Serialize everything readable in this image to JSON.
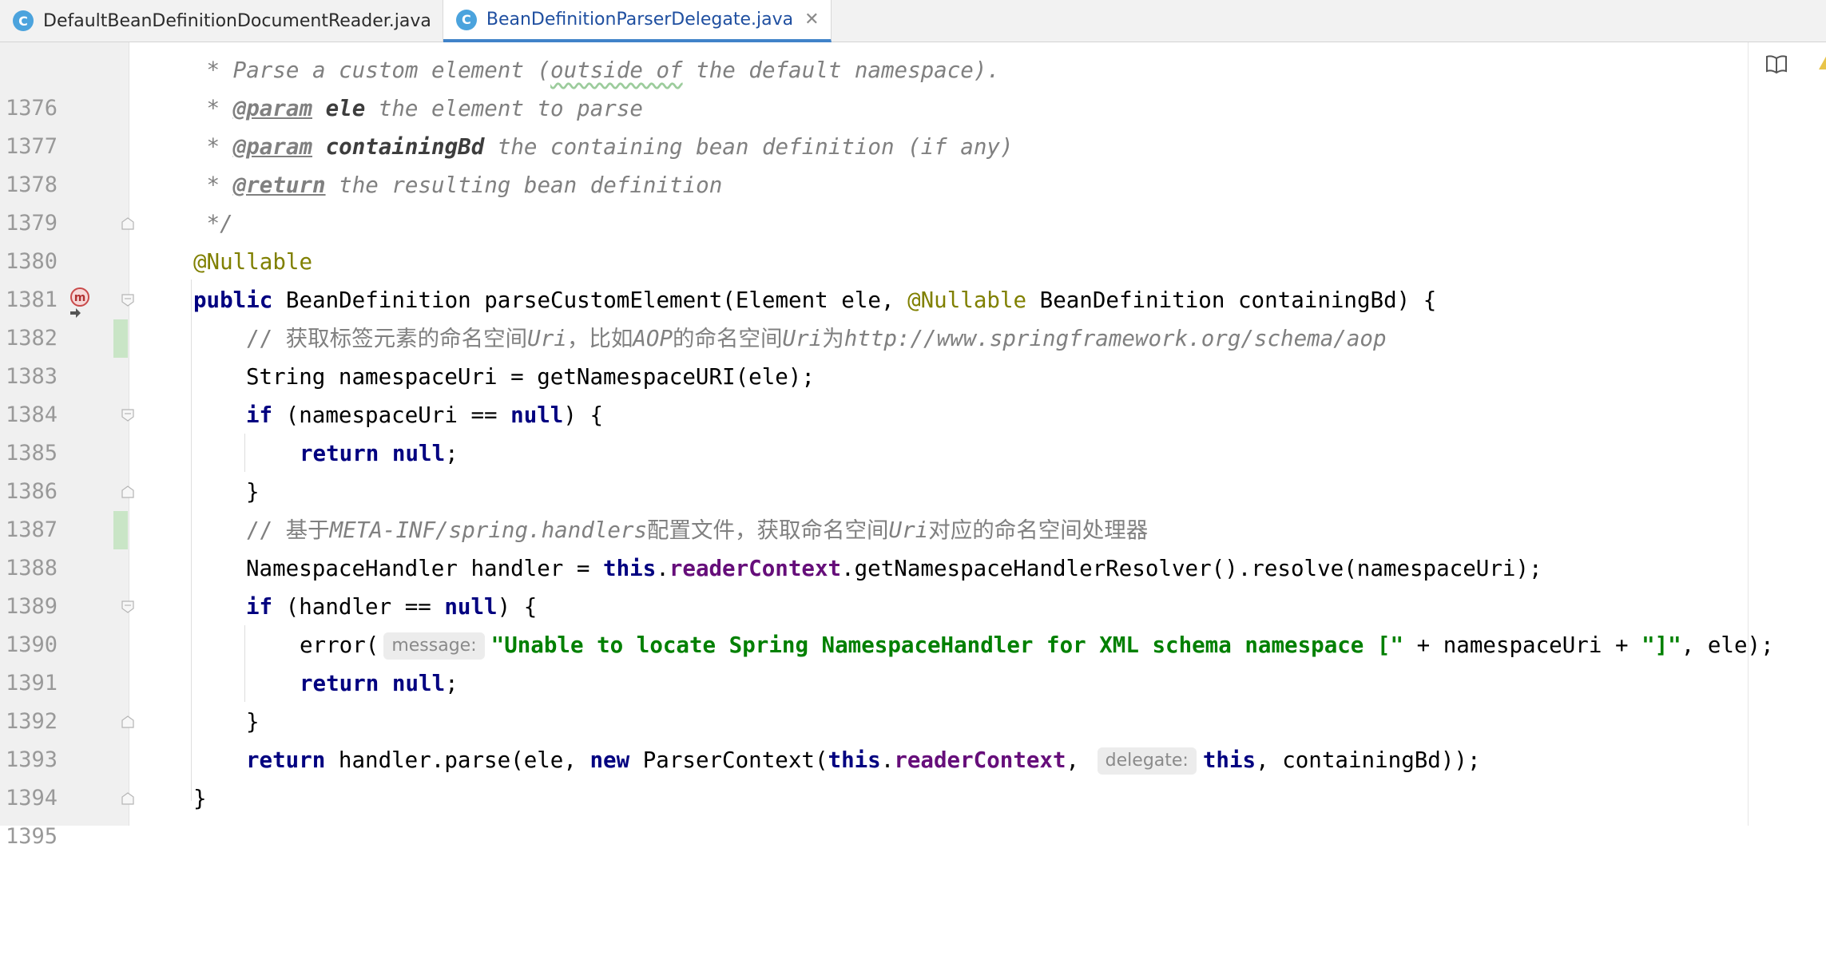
{
  "tabs": [
    {
      "label": "DefaultBeanDefinitionDocumentReader.java",
      "icon": "C",
      "active": false
    },
    {
      "label": "BeanDefinitionParserDelegate.java",
      "icon": "C",
      "active": true
    }
  ],
  "tab_close_glyph": "✕",
  "line_numbers": [
    "1376",
    "1377",
    "1378",
    "1379",
    "1380",
    "1381",
    "1382",
    "1383",
    "1384",
    "1385",
    "1386",
    "1387",
    "1388",
    "1389",
    "1390",
    "1391",
    "1392",
    "1393",
    "1394",
    "1395"
  ],
  "code": {
    "l1376": {
      "a": " * Parse a custom element (",
      "b": "outside of",
      "c": " the default namespace)."
    },
    "l1377": {
      "star": " * ",
      "tag": "@param",
      "name": "ele",
      "rest": " the element to parse"
    },
    "l1378": {
      "star": " * ",
      "tag": "@param",
      "name": "containingBd",
      "rest": " the containing bean definition (if any)"
    },
    "l1379": {
      "star": " * ",
      "tag": "@return",
      "rest": " the resulting bean definition"
    },
    "l1380": {
      "text": " */"
    },
    "l1381": {
      "ann": "@Nullable"
    },
    "l1382": {
      "kw": "public",
      "a": " BeanDefinition parseCustomElement(Element ele, ",
      "ann": "@Nullable",
      "b": " BeanDefinition containingBd) {"
    },
    "l1383": {
      "c1": "// 获取标签元素的命名空间",
      "c2": "Uri",
      "c3": "，比如",
      "c4": "AOP",
      "c5": "的命名空间",
      "c6": "Uri",
      "c7": "为",
      "c8": "http://www.springframework.org/schema/aop"
    },
    "l1384": {
      "text": "String namespaceUri = getNamespaceURI(ele);"
    },
    "l1385": {
      "kw": "if",
      "a": " (namespaceUri == ",
      "kw2": "null",
      "b": ") {"
    },
    "l1386": {
      "kw": "return",
      "sp": " ",
      "kw2": "null",
      "b": ";"
    },
    "l1387": {
      "text": "}"
    },
    "l1388": {
      "c1": "// 基于",
      "c2": "META-INF/spring.handlers",
      "c3": "配置文件，获取命名空间",
      "c4": "Uri",
      "c5": "对应的命名空间处理器"
    },
    "l1389": {
      "a": "NamespaceHandler handler = ",
      "kw": "this",
      "dot": ".",
      "fld": "readerContext",
      "b": ".getNamespaceHandlerResolver().resolve(namespaceUri);"
    },
    "l1390": {
      "kw": "if",
      "a": " (handler == ",
      "kw2": "null",
      "b": ") {"
    },
    "l1391": {
      "a": "error(",
      "hint": "message:",
      "str": "\"Unable to locate Spring NamespaceHandler for XML schema namespace [\"",
      "b": " + namespaceUri + ",
      "str2": "\"]\"",
      "c": ", ele);"
    },
    "l1392": {
      "kw": "return",
      "sp": " ",
      "kw2": "null",
      "b": ";"
    },
    "l1393": {
      "text": "}"
    },
    "l1394": {
      "kw": "return",
      "a": " handler.parse(ele, ",
      "kw2": "new",
      "b": " ParserContext(",
      "kw3": "this",
      "dot": ".",
      "fld": "readerContext",
      "c": ", ",
      "hint": "delegate:",
      "kw4": "this",
      "d": ", containingBd));"
    },
    "l1395": {
      "text": "}"
    }
  },
  "method_icon_letter": "m",
  "colors": {
    "keyword": "#000080",
    "comment": "#808080",
    "annotation": "#808000",
    "field": "#660e7a",
    "string": "#008000",
    "tab_accent": "#4083c9"
  }
}
